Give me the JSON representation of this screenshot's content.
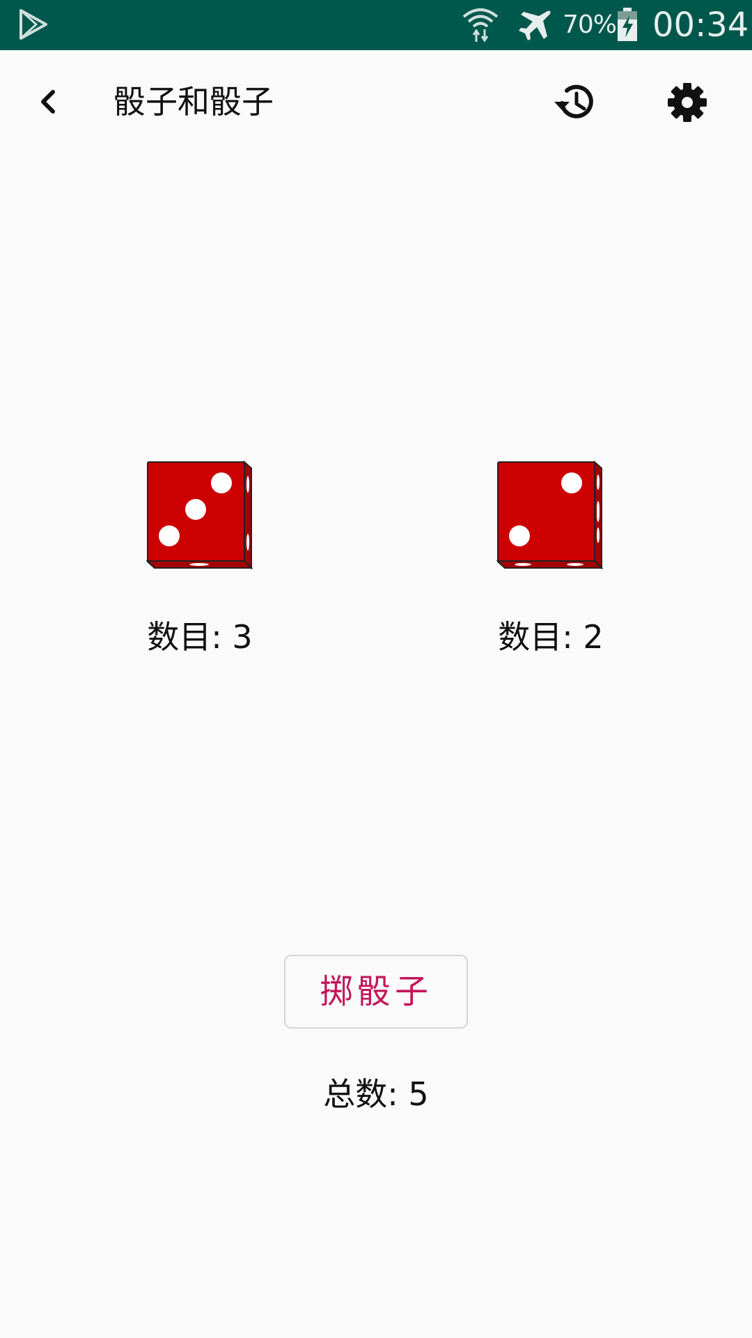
{
  "status_bar": {
    "battery_percent": "70%",
    "time": "00:34",
    "icons": [
      "play-store-icon",
      "wifi-icon",
      "airplane-mode-icon",
      "battery-charging-icon"
    ]
  },
  "app_bar": {
    "title": "骰子和骰子",
    "icons": [
      "back-arrow-icon",
      "history-icon",
      "settings-gear-icon"
    ]
  },
  "dice": [
    {
      "value": 3,
      "label": "数目: 3"
    },
    {
      "value": 2,
      "label": "数目: 2"
    }
  ],
  "roll_button": {
    "label": "掷骰子"
  },
  "total": {
    "label": "总数: 5",
    "value": 5
  },
  "colors": {
    "status_bar": "#00574b",
    "die_red": "#cc0000",
    "button_text": "#c2185b",
    "background": "#fafafa"
  }
}
